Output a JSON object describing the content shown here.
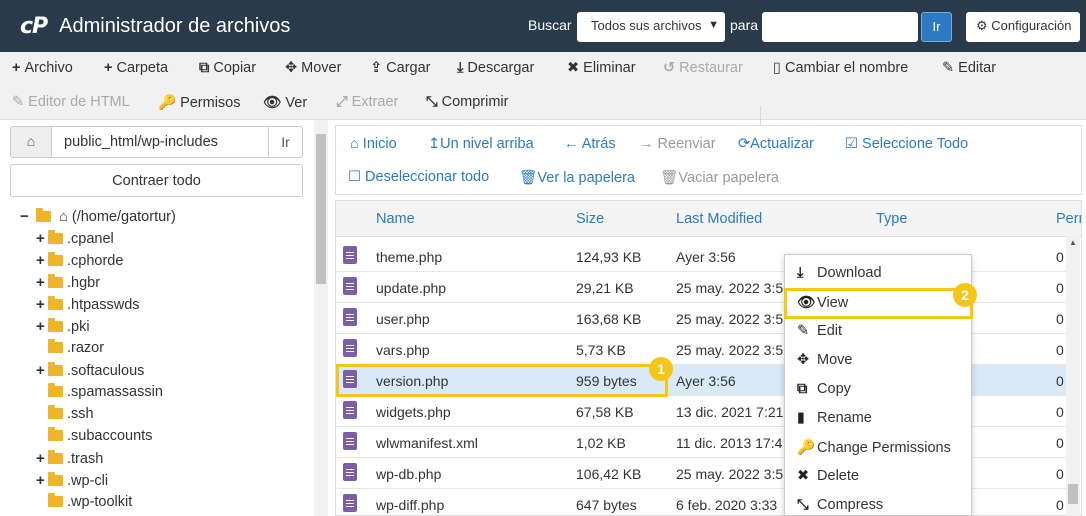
{
  "header": {
    "logo": "cP",
    "title": "Administrador de archivos",
    "search_label": "Buscar",
    "search_scope": "Todos sus archivos",
    "para_label": "para",
    "search_value": "",
    "go_label": "Ir",
    "config_label": "Configuración"
  },
  "toolbar": {
    "row1": [
      {
        "icon": "+",
        "label": "Archivo",
        "name": "new-file-button",
        "enabled": true
      },
      {
        "icon": "+",
        "label": "Carpeta",
        "name": "new-folder-button",
        "enabled": true
      },
      {
        "icon": "⧉",
        "label": "Copiar",
        "name": "copy-button",
        "enabled": true
      },
      {
        "icon": "✥",
        "label": "Mover",
        "name": "move-button",
        "enabled": true
      },
      {
        "icon": "⇪",
        "label": "Cargar",
        "name": "upload-button",
        "enabled": true
      },
      {
        "icon": "⤓",
        "label": "Descargar",
        "name": "download-button",
        "enabled": true
      },
      {
        "icon": "✖",
        "label": "Eliminar",
        "name": "delete-button",
        "enabled": true
      },
      {
        "icon": "↺",
        "label": "Restaurar",
        "name": "restore-button",
        "enabled": false
      },
      {
        "icon": "▯",
        "label": "Cambiar el nombre",
        "name": "rename-button",
        "enabled": true
      },
      {
        "icon": "✎",
        "label": "Editar",
        "name": "edit-button",
        "enabled": true
      }
    ],
    "row2": [
      {
        "icon": "✎",
        "label": "Editor de HTML",
        "name": "html-editor-button",
        "enabled": false
      },
      {
        "icon": "🔑",
        "label": "Permisos",
        "name": "permissions-button",
        "enabled": true
      },
      {
        "icon": "👁",
        "label": "Ver",
        "name": "view-button",
        "enabled": true
      },
      {
        "icon": "⤢",
        "label": "Extraer",
        "name": "extract-button",
        "enabled": false
      },
      {
        "icon": "⤡",
        "label": "Comprimir",
        "name": "compress-button",
        "enabled": true
      }
    ]
  },
  "left": {
    "path": "public_html/wp-includes",
    "go_label": "Ir",
    "collapse_label": "Contraer todo",
    "root_label": "(/home/gatortur)",
    "folders": [
      {
        "label": ".cpanel",
        "expandable": true
      },
      {
        "label": ".cphorde",
        "expandable": true
      },
      {
        "label": ".hgbr",
        "expandable": true
      },
      {
        "label": ".htpasswds",
        "expandable": true
      },
      {
        "label": ".pki",
        "expandable": true
      },
      {
        "label": ".razor",
        "expandable": false
      },
      {
        "label": ".softaculous",
        "expandable": true
      },
      {
        "label": ".spamassassin",
        "expandable": false
      },
      {
        "label": ".ssh",
        "expandable": false
      },
      {
        "label": ".subaccounts",
        "expandable": false
      },
      {
        "label": ".trash",
        "expandable": true
      },
      {
        "label": ".wp-cli",
        "expandable": true
      },
      {
        "label": ".wp-toolkit",
        "expandable": false
      }
    ]
  },
  "nav": {
    "home": "Inicio",
    "up": "Un nivel arriba",
    "back": "Atrás",
    "forward": "Reenviar",
    "refresh": "Actualizar",
    "select_all": "Seleccione Todo",
    "deselect_all": "Deseleccionar todo",
    "view_trash": "Ver la papelera",
    "empty_trash": "Vaciar papelera"
  },
  "table": {
    "headers": {
      "name": "Name",
      "size": "Size",
      "modified": "Last Modified",
      "type": "Type",
      "perms": "Perr"
    },
    "rows": [
      {
        "name": "theme.php",
        "size": "124,93 KB",
        "modified": "Ayer 3:56",
        "type": "",
        "perms": "0",
        "selected": false
      },
      {
        "name": "update.php",
        "size": "29,21 KB",
        "modified": "25 may. 2022 3:5",
        "type": "",
        "perms": "0",
        "selected": false
      },
      {
        "name": "user.php",
        "size": "163,68 KB",
        "modified": "25 may. 2022 3:5",
        "type": "",
        "perms": "0",
        "selected": false
      },
      {
        "name": "vars.php",
        "size": "5,73 KB",
        "modified": "25 may. 2022 3:5",
        "type": "",
        "perms": "0",
        "selected": false
      },
      {
        "name": "version.php",
        "size": "959 bytes",
        "modified": "Ayer 3:56",
        "type": "",
        "perms": "0",
        "selected": true
      },
      {
        "name": "widgets.php",
        "size": "67,58 KB",
        "modified": "13 dic. 2021 7:21",
        "type": "",
        "perms": "0",
        "selected": false
      },
      {
        "name": "wlwmanifest.xml",
        "size": "1,02 KB",
        "modified": "11 dic. 2013 17:4",
        "type": "",
        "perms": "0",
        "selected": false
      },
      {
        "name": "wp-db.php",
        "size": "106,42 KB",
        "modified": "25 may. 2022 3:5",
        "type": "",
        "perms": "0",
        "selected": false
      },
      {
        "name": "wp-diff.php",
        "size": "647 bytes",
        "modified": "6 feb. 2020 3:33",
        "type": "",
        "perms": "0",
        "selected": false
      }
    ]
  },
  "context_menu": [
    {
      "icon": "⤓",
      "label": "Download",
      "name": "ctx-download"
    },
    {
      "icon": "👁",
      "label": "View",
      "name": "ctx-view"
    },
    {
      "icon": "✎",
      "label": "Edit",
      "name": "ctx-edit"
    },
    {
      "icon": "✥",
      "label": "Move",
      "name": "ctx-move"
    },
    {
      "icon": "⧉",
      "label": "Copy",
      "name": "ctx-copy"
    },
    {
      "icon": "▮",
      "label": "Rename",
      "name": "ctx-rename"
    },
    {
      "icon": "🔑",
      "label": "Change Permissions",
      "name": "ctx-change-permissions"
    },
    {
      "icon": "✖",
      "label": "Delete",
      "name": "ctx-delete"
    },
    {
      "icon": "⤡",
      "label": "Compress",
      "name": "ctx-compress"
    }
  ],
  "annotations": {
    "badge1": "1",
    "badge2": "2"
  },
  "colors": {
    "topbar": "#293a4a",
    "link": "#2a7bc1",
    "highlight": "#f5c518",
    "folder": "#f0b429",
    "selected_row": "#d9e9f7"
  }
}
